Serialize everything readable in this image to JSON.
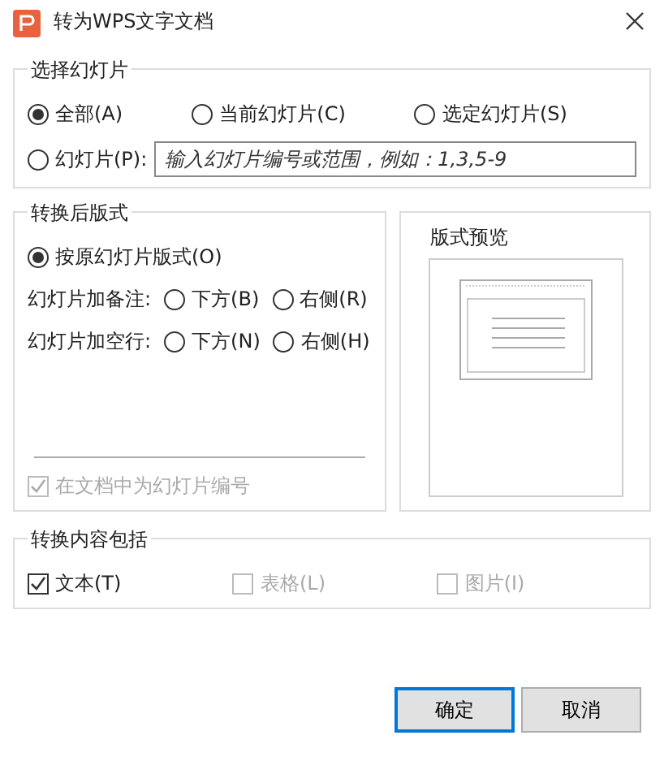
{
  "window": {
    "title": "转为WPS文字文档"
  },
  "slide_range": {
    "title": "选择幻灯片",
    "options": [
      {
        "label": "全部(A)",
        "selected": true
      },
      {
        "label": "当前幻灯片(C)",
        "selected": false
      },
      {
        "label": "选定幻灯片(S)",
        "selected": false
      },
      {
        "label": "幻灯片(P):",
        "selected": false
      }
    ],
    "range_field": {
      "placeholder": "输入幻灯片编号或范围，例如：1,3,5-9"
    }
  },
  "layout": {
    "title": "转换后版式",
    "original": {
      "label": "按原幻灯片版式(O)",
      "selected": true
    },
    "rows": [
      {
        "label": "幻灯片加备注:",
        "options": [
          {
            "label": "下方(B)",
            "selected": false
          },
          {
            "label": "右侧(R)",
            "selected": false
          }
        ]
      },
      {
        "label": "幻灯片加空行:",
        "options": [
          {
            "label": "下方(N)",
            "selected": false
          },
          {
            "label": "右侧(H)",
            "selected": false
          }
        ]
      }
    ],
    "number_slides": {
      "label": "在文档中为幻灯片编号",
      "checked": true,
      "disabled": true
    }
  },
  "preview": {
    "title": "版式预览"
  },
  "content": {
    "title": "转换内容包括",
    "items": [
      {
        "label": "文本(T)",
        "checked": true,
        "disabled": false
      },
      {
        "label": "表格(L)",
        "checked": false,
        "disabled": true
      },
      {
        "label": "图片(I)",
        "checked": false,
        "disabled": true
      }
    ]
  },
  "buttons": [
    {
      "label": "确定",
      "default": true
    },
    {
      "label": "取消",
      "default": false
    }
  ]
}
